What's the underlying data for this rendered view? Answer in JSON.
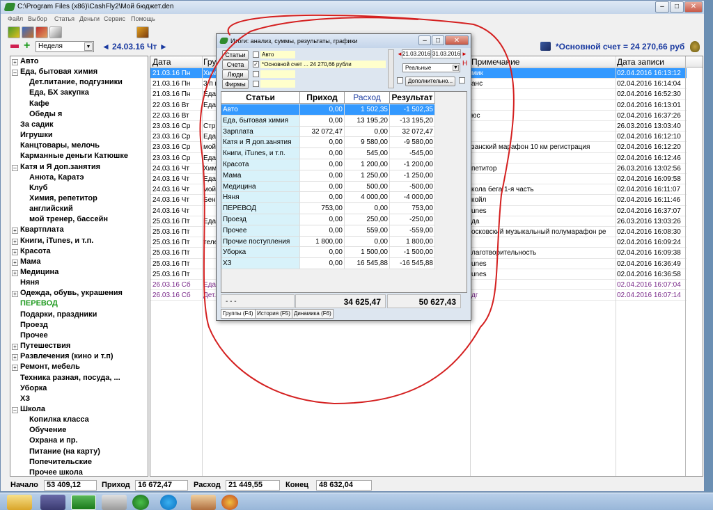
{
  "window": {
    "title": "C:\\Program Files (x86)\\CashFly2\\Мой бюджет.den",
    "controls": [
      "–",
      "□",
      "✕"
    ]
  },
  "menu": [
    "Файл",
    "Выбор",
    "Статья",
    "Деньги",
    "Сервис",
    "Помощь"
  ],
  "nav": {
    "period": "Неделя",
    "date": "24.03.16 Чт",
    "account_summary": "*Основной счет = 24 270,66 руб"
  },
  "tree": [
    {
      "label": "Авто",
      "level": 0,
      "expander": "+"
    },
    {
      "label": "Еда, бытовая химия",
      "level": 0,
      "expander": "–"
    },
    {
      "label": "Дет.питание, подгузники",
      "level": 1
    },
    {
      "label": "Еда, БХ закупка",
      "level": 1
    },
    {
      "label": "Кафе",
      "level": 1
    },
    {
      "label": "Обеды я",
      "level": 1
    },
    {
      "label": "За садик",
      "level": 0
    },
    {
      "label": "Игрушки",
      "level": 0
    },
    {
      "label": "Канцтовары, мелочь",
      "level": 0
    },
    {
      "label": "Карманные деньги Катюшке",
      "level": 0
    },
    {
      "label": "Катя и Я доп.занятия",
      "level": 0,
      "expander": "–"
    },
    {
      "label": "Анюта, Каратэ",
      "level": 1
    },
    {
      "label": "Клуб",
      "level": 1
    },
    {
      "label": "Химия, репетитор",
      "level": 1
    },
    {
      "label": "английский",
      "level": 1
    },
    {
      "label": "мой тренер, бассейн",
      "level": 1
    },
    {
      "label": "Квартплата",
      "level": 0,
      "expander": "+"
    },
    {
      "label": "Книги, iTunes, и т.п.",
      "level": 0,
      "expander": "+"
    },
    {
      "label": "Красота",
      "level": 0,
      "expander": "+"
    },
    {
      "label": "Мама",
      "level": 0,
      "expander": "+"
    },
    {
      "label": "Медицина",
      "level": 0,
      "expander": "+"
    },
    {
      "label": "Няня",
      "level": 0
    },
    {
      "label": "Одежда, обувь, украшения",
      "level": 0,
      "expander": "+"
    },
    {
      "label": "ПЕРЕВОД",
      "level": 0,
      "green": true
    },
    {
      "label": "Подарки, праздники",
      "level": 0
    },
    {
      "label": "Проезд",
      "level": 0
    },
    {
      "label": "Прочее",
      "level": 0
    },
    {
      "label": "Путешествия",
      "level": 0,
      "expander": "+"
    },
    {
      "label": "Развлечения (кино и т.п)",
      "level": 0,
      "expander": "+"
    },
    {
      "label": "Ремонт, мебель",
      "level": 0,
      "expander": "+"
    },
    {
      "label": "Техника разная, посуда, ...",
      "level": 0
    },
    {
      "label": "Уборка",
      "level": 0
    },
    {
      "label": "ХЗ",
      "level": 0
    },
    {
      "label": "Школа",
      "level": 0,
      "expander": "–"
    },
    {
      "label": "Копилка класса",
      "level": 1
    },
    {
      "label": "Обучение",
      "level": 1
    },
    {
      "label": "Охрана и пр.",
      "level": 1
    },
    {
      "label": "Питание (на карту)",
      "level": 1
    },
    {
      "label": "Попечительские",
      "level": 1
    },
    {
      "label": "Прочее школа",
      "level": 1
    }
  ],
  "table": {
    "headers": [
      "Дата",
      "Гру",
      "Примечание",
      "Дата записи"
    ],
    "rows": [
      {
        "date": "21.03.16 Пн",
        "group": "Хим",
        "note": "мик",
        "recorded": "02.04.2016 16:13:12",
        "selected": true
      },
      {
        "date": "21.03.16 Пн",
        "group": "3/п н",
        "note": "анс",
        "recorded": "02.04.2016 16:14:04"
      },
      {
        "date": "21.03.16 Пн",
        "group": "Еда,",
        "note": "",
        "recorded": "02.04.2016 16:52:30"
      },
      {
        "date": "22.03.16 Вт",
        "group": "Еда,",
        "note": "",
        "recorded": "02.04.2016 16:13:01"
      },
      {
        "date": "22.03.16 Вт",
        "group": "",
        "note": "юс",
        "recorded": "02.04.2016 16:37:26"
      },
      {
        "date": "23.03.16 Ср",
        "group": "Стри",
        "note": "",
        "recorded": "26.03.2016 13:03:40"
      },
      {
        "date": "23.03.16 Ср",
        "group": "Еда,",
        "note": "",
        "recorded": "02.04.2016 16:12:10"
      },
      {
        "date": "23.03.16 Ср",
        "group": "мой",
        "note": "занский марафон 10 км регистрация",
        "recorded": "02.04.2016 16:12:20"
      },
      {
        "date": "23.03.16 Ср",
        "group": "Еда,",
        "note": "",
        "recorded": "02.04.2016 16:12:46"
      },
      {
        "date": "24.03.16 Чт",
        "group": "Хим",
        "note": "петитор",
        "recorded": "26.03.2016 13:02:56"
      },
      {
        "date": "24.03.16 Чт",
        "group": "Еда,",
        "note": "",
        "recorded": "02.04.2016 16:09:58"
      },
      {
        "date": "24.03.16 Чт",
        "group": "мой",
        "note": "кола бега 1-я часть",
        "recorded": "02.04.2016 16:11:07"
      },
      {
        "date": "24.03.16 Чт",
        "group": "Бенз",
        "note": "койл",
        "recorded": "02.04.2016 16:11:46"
      },
      {
        "date": "24.03.16 Чт",
        "group": "",
        "note": "unes",
        "recorded": "02.04.2016 16:37:07"
      },
      {
        "date": "25.03.16 Пт",
        "group": "Еда,",
        "note": "да",
        "recorded": "26.03.2016 13:03:26"
      },
      {
        "date": "25.03.16 Пт",
        "group": "",
        "note": "осковский музыкальный полумарафон ре",
        "recorded": "02.04.2016 16:08:30"
      },
      {
        "date": "25.03.16 Пт",
        "group": "теле",
        "note": "",
        "recorded": "02.04.2016 16:09:24"
      },
      {
        "date": "25.03.16 Пт",
        "group": "",
        "note": "лаготворительность",
        "recorded": "02.04.2016 16:09:38"
      },
      {
        "date": "25.03.16 Пт",
        "group": "",
        "note": "unes",
        "recorded": "02.04.2016 16:36:49"
      },
      {
        "date": "25.03.16 Пт",
        "group": "",
        "note": "unes",
        "recorded": "02.04.2016 16:36:58"
      },
      {
        "date": "26.03.16 Сб",
        "group": "Еда",
        "note": "",
        "recorded": "02.04.2016 16:07:04",
        "purple": true
      },
      {
        "date": "26.03.16 Сб",
        "group": "Дет.",
        "note": "дг",
        "recorded": "02.04.2016 16:07:14",
        "purple": true
      }
    ]
  },
  "status": {
    "start_label": "Начало",
    "start_value": "53 409,12",
    "income_label": "Приход",
    "income_value": "16 672,47",
    "expense_label": "Расход",
    "expense_value": "21 449,55",
    "end_label": "Конец",
    "end_value": "48 632,04"
  },
  "dialog": {
    "title": "Итоги:  анализ, суммы, результаты, графики",
    "filter_buttons": [
      "Статьи",
      "Счета",
      "Люди",
      "Фирмы"
    ],
    "filter_values": [
      "Авто",
      "*Основной счет ...   24 270,66 рубли",
      "",
      ""
    ],
    "date_from": "21.03.2016",
    "date_to": "31.03.2016",
    "h_label": "Н",
    "mode": "Реальные",
    "extra_button": "Дополнительно...",
    "headers": [
      "Статьи",
      "Приход",
      "Расход",
      "Результат"
    ],
    "rows": [
      {
        "name": "Авто",
        "income": "0,00",
        "expense": "1 502,35",
        "result": "-1 502,35",
        "selected": true
      },
      {
        "name": "Еда, бытовая химия",
        "income": "0,00",
        "expense": "13 195,20",
        "result": "-13 195,20"
      },
      {
        "name": "Зарплата",
        "income": "32 072,47",
        "expense": "0,00",
        "result": "32 072,47"
      },
      {
        "name": "Катя и Я доп.занятия",
        "income": "0,00",
        "expense": "9 580,00",
        "result": "-9 580,00"
      },
      {
        "name": "Книги, iTunes, и т.п.",
        "income": "0,00",
        "expense": "545,00",
        "result": "-545,00"
      },
      {
        "name": "Красота",
        "income": "0,00",
        "expense": "1 200,00",
        "result": "-1 200,00"
      },
      {
        "name": "Мама",
        "income": "0,00",
        "expense": "1 250,00",
        "result": "-1 250,00"
      },
      {
        "name": "Медицина",
        "income": "0,00",
        "expense": "500,00",
        "result": "-500,00"
      },
      {
        "name": "Няня",
        "income": "0,00",
        "expense": "4 000,00",
        "result": "-4 000,00"
      },
      {
        "name": "ПЕРЕВОД",
        "income": "753,00",
        "expense": "0,00",
        "result": "753,00"
      },
      {
        "name": "Проезд",
        "income": "0,00",
        "expense": "250,00",
        "result": "-250,00"
      },
      {
        "name": "Прочее",
        "income": "0,00",
        "expense": "559,00",
        "result": "-559,00"
      },
      {
        "name": "Прочие поступления",
        "income": "1 800,00",
        "expense": "0,00",
        "result": "1 800,00"
      },
      {
        "name": "Уборка",
        "income": "0,00",
        "expense": "1 500,00",
        "result": "-1 500,00"
      },
      {
        "name": "ХЗ",
        "income": "0,00",
        "expense": "16 545,88",
        "result": "-16 545,88"
      }
    ],
    "total_label": "- - -",
    "total_income": "34 625,47",
    "total_expense": "50 627,43",
    "tabs": [
      "Группы (F4)",
      "История (F5)",
      "Динамика (F6)"
    ]
  },
  "colors": {
    "selection": "#3399ff",
    "nav_blue": "#1a3aa0",
    "annotation_red": "#d42020",
    "green_item": "#1f9a1f",
    "purple_row": "#7a2a8a"
  },
  "icons": [
    "app-icon",
    "folder-open-icon",
    "users-icon",
    "brush-icon",
    "edit-icon",
    "exit-icon",
    "minus-icon",
    "plus-icon",
    "money-bag-icon"
  ]
}
